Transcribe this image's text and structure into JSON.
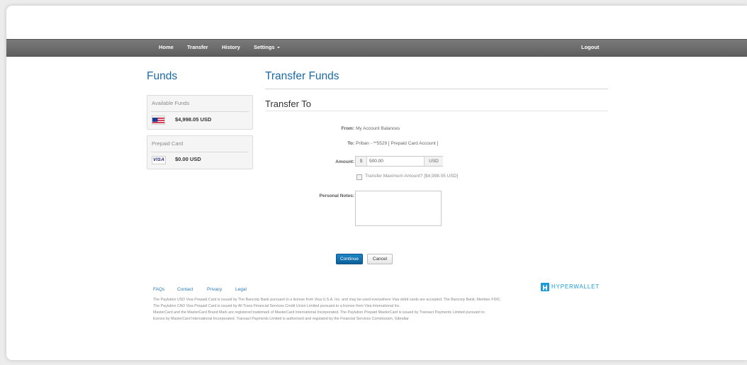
{
  "nav": {
    "home": "Home",
    "transfer": "Transfer",
    "history": "History",
    "settings": "Settings",
    "logout": "Logout"
  },
  "sidebar": {
    "title": "Funds",
    "available": {
      "label": "Available Funds",
      "amount": "$4,998.05 USD"
    },
    "prepaid": {
      "label": "Prepaid Card",
      "amount": "$0.00 USD"
    }
  },
  "main": {
    "title": "Transfer Funds",
    "section": "Transfer To",
    "from": {
      "label": "From:",
      "value": "My Account Balances"
    },
    "to": {
      "label": "To:",
      "value": "Priban - **5529 [ Prepaid Card Account ]"
    },
    "amount": {
      "label": "Amount:",
      "prefix": "$",
      "value": "500.00",
      "suffix": "USD"
    },
    "max_checkbox": "Transfer Maximum Amount? [$4,998.05 USD]",
    "notes": {
      "label": "Personal Notes:",
      "value": ""
    },
    "continue": "Continue",
    "cancel": "Cancel"
  },
  "footer": {
    "links": [
      "FAQs",
      "Contact",
      "Privacy",
      "Legal"
    ],
    "logo_text": "HYPERWALLET",
    "lines": [
      "The Paylution USD Visa Prepaid Card is issued by The Bancorp Bank pursuant to a license from Visa U.S.A. Inc. and may be used everywhere Visa debit cards are accepted. The Bancorp Bank; Member FDIC.",
      "The Paylution CAD Visa Prepaid Card is issued by All Trans Financial Services Credit Union Limited pursuant to a license from Visa International Inc.",
      "MasterCard and the MasterCard Brand Mark are registered trademark of MasterCard International Incorporated. The Paylution Prepaid MasterCard is issued by Transact Payments Limited pursuant to",
      "licence by MasterCard International Incorporated. Transact Payments Limited is authorised and regulated by the Financial Services Commission, Gibraltar"
    ]
  },
  "colors": {
    "accent": "#1b6aa5",
    "nav_bg": "#6b6b6b",
    "button_primary": "#0f6aa8",
    "logo": "#1a9ad6"
  }
}
